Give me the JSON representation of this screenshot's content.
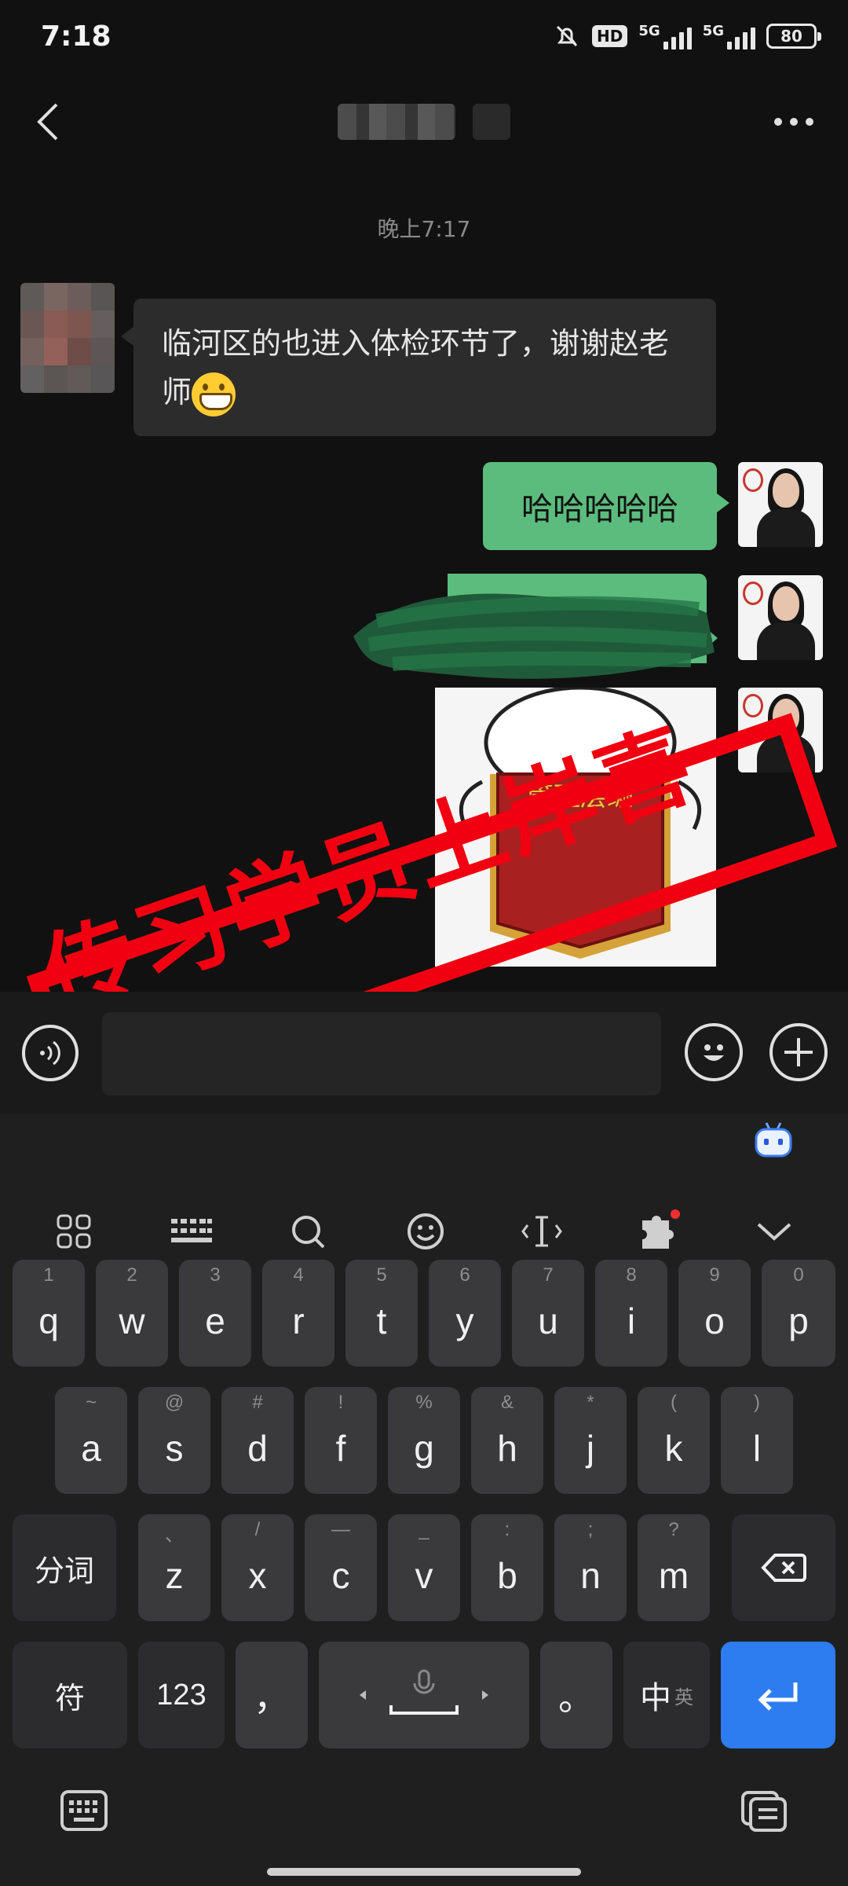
{
  "status": {
    "time": "7:18",
    "hd": "HD",
    "net1": "5G",
    "net2": "5G",
    "battery": "80"
  },
  "chat": {
    "timestamp": "晚上7:17",
    "messages": [
      {
        "from": "contact",
        "text": "临河区的也进入体检环节了，谢谢赵老师",
        "emoji": "grinning-face"
      },
      {
        "from": "me",
        "text": "哈哈哈哈哈"
      },
      {
        "from": "me",
        "text": ""
      },
      {
        "from": "me",
        "type": "sticker",
        "text": "管理层编"
      }
    ]
  },
  "watermark": {
    "text": "传习学员上岸喜报"
  },
  "keyboard": {
    "rows": [
      [
        {
          "k": "q",
          "h": "1"
        },
        {
          "k": "w",
          "h": "2"
        },
        {
          "k": "e",
          "h": "3"
        },
        {
          "k": "r",
          "h": "4"
        },
        {
          "k": "t",
          "h": "5"
        },
        {
          "k": "y",
          "h": "6"
        },
        {
          "k": "u",
          "h": "7"
        },
        {
          "k": "i",
          "h": "8"
        },
        {
          "k": "o",
          "h": "9"
        },
        {
          "k": "p",
          "h": "0"
        }
      ],
      [
        {
          "k": "a",
          "h": "~"
        },
        {
          "k": "s",
          "h": "@"
        },
        {
          "k": "d",
          "h": "#"
        },
        {
          "k": "f",
          "h": "!"
        },
        {
          "k": "g",
          "h": "%"
        },
        {
          "k": "h",
          "h": "&"
        },
        {
          "k": "j",
          "h": "*"
        },
        {
          "k": "k",
          "h": "("
        },
        {
          "k": "l",
          "h": ")"
        }
      ],
      [
        {
          "k": "z",
          "h": "、"
        },
        {
          "k": "x",
          "h": "/"
        },
        {
          "k": "c",
          "h": "—"
        },
        {
          "k": "v",
          "h": "_"
        },
        {
          "k": "b",
          "h": ":"
        },
        {
          "k": "n",
          "h": ";"
        },
        {
          "k": "m",
          "h": "?"
        }
      ]
    ],
    "fenci": "分词",
    "fu": "符",
    "num": "123",
    "comma": "，",
    "period": "。",
    "zh": "中",
    "en": "英",
    "icons": [
      "apps-grid-icon",
      "keyboard-icon",
      "search-icon",
      "emoji-icon",
      "cursor-icon",
      "plugin-icon",
      "chevron-down-icon"
    ]
  }
}
